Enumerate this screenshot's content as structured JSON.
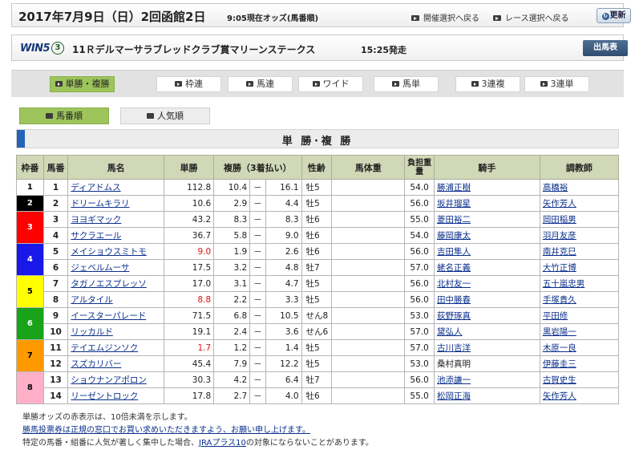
{
  "header": {
    "date_title": "2017年7月9日（日）2回函館2日",
    "as_of": "9:05現在オッズ(馬番順)",
    "nav_meeting": "開催選択へ戻る",
    "nav_race": "レース選択へ戻る",
    "refresh_label": "更新"
  },
  "race": {
    "win5_logo": "WIN5",
    "win5_leg": "③",
    "name": "11Ｒデルマーサラブレッドクラブ賞マリーンステークス",
    "start_time": "15:25発走",
    "entry_button": "出馬表"
  },
  "tabs": [
    "単勝・複勝",
    "枠連",
    "馬連",
    "ワイド",
    "馬単",
    "3連複",
    "3連単"
  ],
  "subtabs": [
    "馬番順",
    "人気順"
  ],
  "section_title": "単 勝･複 勝",
  "columns": {
    "waku": "枠番",
    "uma": "馬番",
    "name": "馬名",
    "win": "単勝",
    "place": "複勝（3着払い）",
    "sex_age": "性齢",
    "weight": "馬体重",
    "load": "負担重量",
    "jockey": "騎手",
    "trainer": "調教師"
  },
  "waku_groups": [
    {
      "label": "1",
      "rows": 1,
      "bg": "#ffffff",
      "fg": "#000000"
    },
    {
      "label": "2",
      "rows": 1,
      "bg": "#000000",
      "fg": "#ffffff"
    },
    {
      "label": "3",
      "rows": 2,
      "bg": "#ff0000",
      "fg": "#ffffff"
    },
    {
      "label": "4",
      "rows": 2,
      "bg": "#1818e8",
      "fg": "#ffffff"
    },
    {
      "label": "5",
      "rows": 2,
      "bg": "#ffff00",
      "fg": "#000000"
    },
    {
      "label": "6",
      "rows": 2,
      "bg": "#19a319",
      "fg": "#ffffff"
    },
    {
      "label": "7",
      "rows": 2,
      "bg": "#ff9900",
      "fg": "#000000"
    },
    {
      "label": "8",
      "rows": 2,
      "bg": "#ffb0c8",
      "fg": "#000000"
    }
  ],
  "horses": [
    {
      "uma": "1",
      "name": "ディアドムス",
      "win": "112.8",
      "win_hi": false,
      "p_lo": "10.4",
      "p_hi": "16.1",
      "sa": "牡5",
      "weight": "",
      "load": "54.0",
      "jockey": "勝浦正樹",
      "jockey_link": true,
      "trainer": "高橋裕"
    },
    {
      "uma": "2",
      "name": "ドリームキラリ",
      "win": "10.6",
      "win_hi": false,
      "p_lo": "2.9",
      "p_hi": "4.4",
      "sa": "牡5",
      "weight": "",
      "load": "56.0",
      "jockey": "坂井瑠星",
      "jockey_link": true,
      "trainer": "矢作芳人"
    },
    {
      "uma": "3",
      "name": "ヨヨギマック",
      "win": "43.2",
      "win_hi": false,
      "p_lo": "8.3",
      "p_hi": "8.3",
      "sa": "牡6",
      "weight": "",
      "load": "55.0",
      "jockey": "菱田裕二",
      "jockey_link": true,
      "trainer": "岡田稲男"
    },
    {
      "uma": "4",
      "name": "サクラエール",
      "win": "36.7",
      "win_hi": false,
      "p_lo": "5.8",
      "p_hi": "9.0",
      "sa": "牡6",
      "weight": "",
      "load": "54.0",
      "jockey": "藤岡康太",
      "jockey_link": true,
      "trainer": "羽月友彦"
    },
    {
      "uma": "5",
      "name": "メイショウスミトモ",
      "win": "9.0",
      "win_hi": true,
      "p_lo": "1.9",
      "p_hi": "2.6",
      "sa": "牡6",
      "weight": "",
      "load": "56.0",
      "jockey": "吉田隼人",
      "jockey_link": true,
      "trainer": "南井克巳"
    },
    {
      "uma": "6",
      "name": "ジェベルムーサ",
      "win": "17.5",
      "win_hi": false,
      "p_lo": "3.2",
      "p_hi": "4.8",
      "sa": "牡7",
      "weight": "",
      "load": "57.0",
      "jockey": "蛯名正義",
      "jockey_link": true,
      "trainer": "大竹正博"
    },
    {
      "uma": "7",
      "name": "タガノエスプレッソ",
      "win": "17.0",
      "win_hi": false,
      "p_lo": "3.1",
      "p_hi": "4.7",
      "sa": "牡5",
      "weight": "",
      "load": "56.0",
      "jockey": "北村友一",
      "jockey_link": true,
      "trainer": "五十嵐忠男"
    },
    {
      "uma": "8",
      "name": "アルタイル",
      "win": "8.8",
      "win_hi": true,
      "p_lo": "2.2",
      "p_hi": "3.3",
      "sa": "牡5",
      "weight": "",
      "load": "56.0",
      "jockey": "田中勝春",
      "jockey_link": true,
      "trainer": "手塚貴久"
    },
    {
      "uma": "9",
      "name": "イースターパレード",
      "win": "71.5",
      "win_hi": false,
      "p_lo": "6.8",
      "p_hi": "10.5",
      "sa": "せん8",
      "weight": "",
      "load": "53.0",
      "jockey": "荻野琢真",
      "jockey_link": true,
      "trainer": "平田修"
    },
    {
      "uma": "10",
      "name": "リッカルド",
      "win": "19.1",
      "win_hi": false,
      "p_lo": "2.4",
      "p_hi": "3.6",
      "sa": "せん6",
      "weight": "",
      "load": "57.0",
      "jockey": "黛弘人",
      "jockey_link": true,
      "trainer": "黒岩陽一"
    },
    {
      "uma": "11",
      "name": "テイエムジンソク",
      "win": "1.7",
      "win_hi": true,
      "p_lo": "1.2",
      "p_hi": "1.4",
      "sa": "牡5",
      "weight": "",
      "load": "57.0",
      "jockey": "古川吉洋",
      "jockey_link": true,
      "trainer": "木原一良"
    },
    {
      "uma": "12",
      "name": "スズカリバー",
      "win": "45.4",
      "win_hi": false,
      "p_lo": "7.9",
      "p_hi": "12.2",
      "sa": "牡5",
      "weight": "",
      "load": "53.0",
      "jockey": "桑村真明",
      "jockey_link": false,
      "trainer": "伊藤圭三"
    },
    {
      "uma": "13",
      "name": "ショウナンアポロン",
      "win": "30.3",
      "win_hi": false,
      "p_lo": "4.2",
      "p_hi": "6.4",
      "sa": "牡7",
      "weight": "",
      "load": "56.0",
      "jockey": "池添謙一",
      "jockey_link": true,
      "trainer": "古賀史生"
    },
    {
      "uma": "14",
      "name": "リーゼントロック",
      "win": "17.8",
      "win_hi": false,
      "p_lo": "2.7",
      "p_hi": "4.0",
      "sa": "牡6",
      "weight": "",
      "load": "55.0",
      "jockey": "松岡正海",
      "jockey_link": true,
      "trainer": "矢作芳人"
    }
  ],
  "dash": "－",
  "notes": {
    "line1": "単勝オッズの赤表示は、10倍未満を示します。",
    "line2": "勝馬投票券は正規の窓口でお買い求めいただきますよう、お願い申し上げます。",
    "line3_pre": "特定の馬番・組番に人気が著しく集中した場合、",
    "line3_link": "JRAプラス10",
    "line3_post": "の対象にならないことがあります。"
  }
}
